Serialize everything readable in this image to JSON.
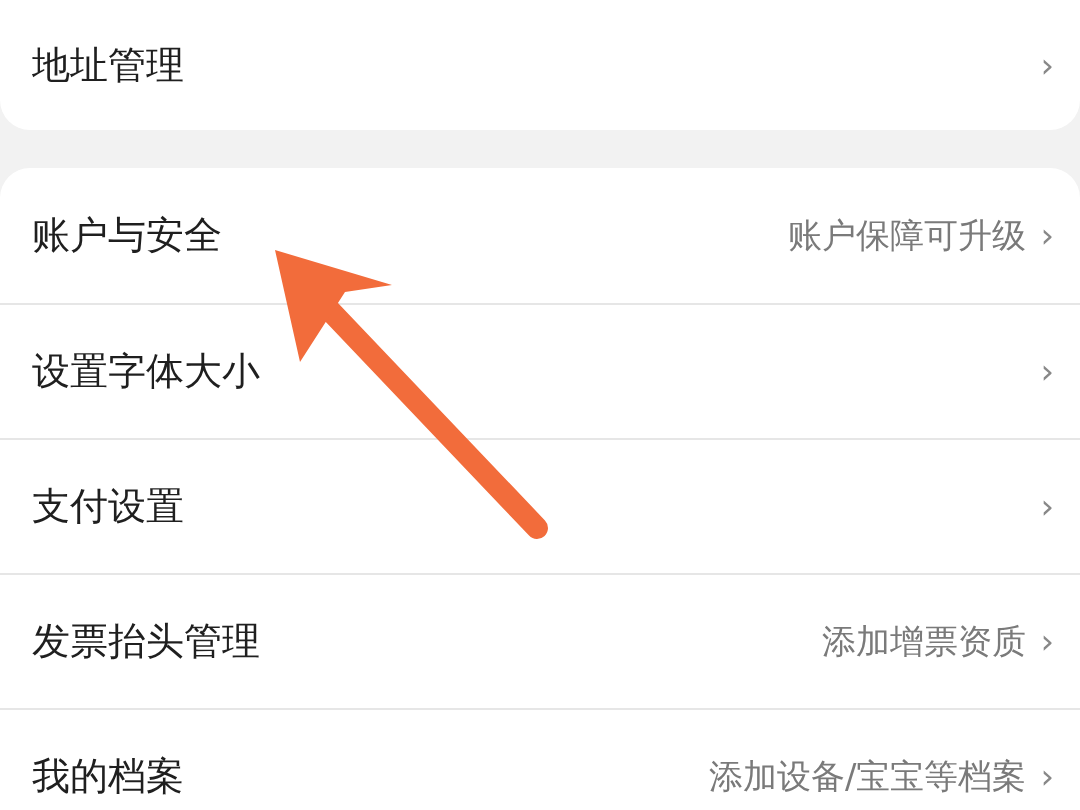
{
  "groups": [
    {
      "items": [
        {
          "label": "地址管理",
          "chevron": "›"
        }
      ]
    },
    {
      "items": [
        {
          "label": "账户与安全",
          "detail": "账户保障可升级",
          "chevron": "›"
        },
        {
          "label": "设置字体大小",
          "chevron": "›"
        },
        {
          "label": "支付设置",
          "chevron": "›"
        },
        {
          "label": "发票抬头管理",
          "detail": "添加增票资质",
          "chevron": "›"
        },
        {
          "label": "我的档案",
          "detail": "添加设备/宝宝等档案",
          "chevron": "›"
        }
      ]
    }
  ]
}
